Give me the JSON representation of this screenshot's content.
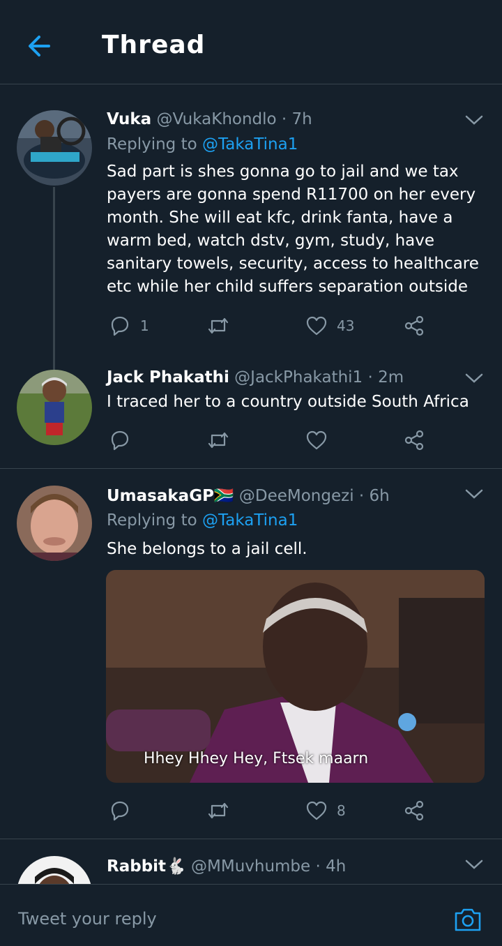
{
  "header": {
    "title": "Thread"
  },
  "tweets": [
    {
      "name": "Vuka",
      "handle": "@VukaKhondlo · 7h",
      "replying_prefix": "Replying to ",
      "replying_to": "@TakaTina1",
      "text": "Sad part is shes gonna go to jail and we tax payers are gonna spend R11700 on her every month. She will eat kfc, drink fanta, have a warm bed, watch dstv, gym, study, have sanitary towels, security, access to healthcare etc while her child suffers separation outside",
      "replies": "1",
      "retweets": "",
      "likes": "43"
    },
    {
      "name": "Jack Phakathi",
      "handle": "@JackPhakathi1 · 2m",
      "text": "I traced her to a  country outside South Africa",
      "replies": "",
      "retweets": "",
      "likes": ""
    },
    {
      "name": "UmasakaGP🇿🇦",
      "handle": "@DeeMongezi · 6h",
      "replying_prefix": "Replying to ",
      "replying_to": "@TakaTina1",
      "text": "She belongs to a jail cell.",
      "media_caption": "Hhey Hhey Hey, Ftsek maarn",
      "replies": "",
      "retweets": "",
      "likes": "8"
    },
    {
      "name": "Rabbit🐇",
      "handle": "@MMuvhumbe · 4h"
    }
  ],
  "composer": {
    "placeholder": "Tweet your reply"
  },
  "colors": {
    "background": "#15202b",
    "accent": "#1da1f2",
    "muted": "#8899a6",
    "divider": "#38444d"
  },
  "icons": [
    "back-arrow-icon",
    "chevron-down-icon",
    "reply-icon",
    "retweet-icon",
    "like-icon",
    "share-icon",
    "camera-icon"
  ]
}
